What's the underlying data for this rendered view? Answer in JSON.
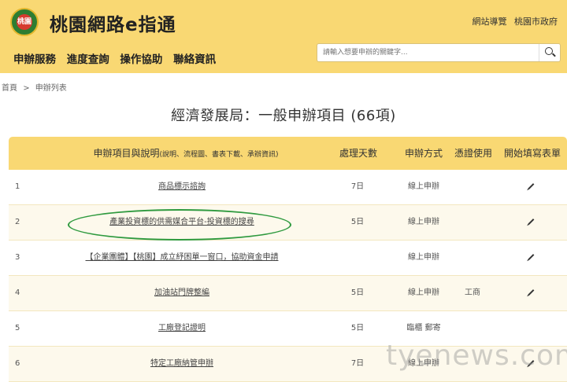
{
  "header": {
    "logo_text": "桃園",
    "site_title": "桃園網路e指通",
    "top_links": [
      "網站導覽",
      "桃園市政府"
    ],
    "nav": [
      "申辦服務",
      "進度查詢",
      "操作協助",
      "聯絡資訊"
    ],
    "search_placeholder": "請輸入想要申辦的關鍵字..."
  },
  "breadcrumb": [
    "首頁",
    ">",
    "申辦列表"
  ],
  "page_heading": "經濟發展局：一般申辦項目 (66項)",
  "table": {
    "headers": {
      "name": "申辦項目與說明",
      "name_sub": "(說明、流程圖、書表下載、承辦資訊)",
      "days": "處理天數",
      "method": "申辦方式",
      "cert": "憑證使用",
      "form": "開始填寫表單"
    },
    "rows": [
      {
        "num": "1",
        "name": "商品標示諮詢",
        "days": "7日",
        "method": "線上申辦",
        "cert": "",
        "form_icon": "pencil-icon"
      },
      {
        "num": "2",
        "name": "產業投資標的供需媒合平台-投資標的搜尋",
        "days": "5日",
        "method": "線上申辦",
        "cert": "",
        "form_icon": "pencil-icon"
      },
      {
        "num": "3",
        "name": "【企業團體】【桃園】成立紓困單一窗口，協助資金申請",
        "days": "",
        "method": "線上申辦",
        "cert": "",
        "form_icon": "pencil-icon"
      },
      {
        "num": "4",
        "name": "加油站門牌整編",
        "days": "5日",
        "method": "線上申辦",
        "cert": "工商",
        "form_icon": "pencil-icon"
      },
      {
        "num": "5",
        "name": "工廠登記證明",
        "days": "5日",
        "method": "臨櫃 郵寄",
        "cert": "",
        "form_icon": ""
      },
      {
        "num": "6",
        "name": "特定工廠納管申辦",
        "days": "7日",
        "method": "線上申辦",
        "cert": "",
        "form_icon": "pencil-icon"
      }
    ]
  },
  "watermark": "tyenews.com",
  "colors": {
    "header_bg": "#f9d873",
    "highlight_ellipse": "#2f9a3f",
    "row_alt": "#fdf9ec"
  }
}
